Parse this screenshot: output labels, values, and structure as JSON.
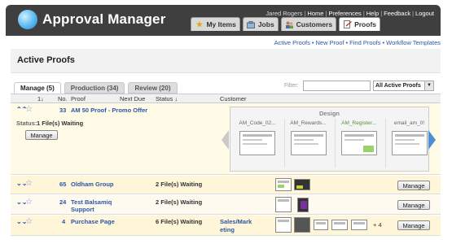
{
  "app": {
    "title": "Approval Manager"
  },
  "user_links": {
    "user": "Jared Rogers",
    "home": "Home",
    "preferences": "Preferences",
    "help": "Help",
    "feedback": "Feedback",
    "logout": "Logout"
  },
  "main_tabs": [
    {
      "label": "My Items",
      "icon": "star-icon"
    },
    {
      "label": "Jobs",
      "icon": "jobs-icon"
    },
    {
      "label": "Customers",
      "icon": "customers-icon"
    },
    {
      "label": "Proofs",
      "icon": "proofs-icon"
    }
  ],
  "subnav": [
    "Active Proofs",
    "New Proof",
    "Find Proofs",
    "Workflow Templates"
  ],
  "page_title": "Active Proofs",
  "subtabs": [
    "Manage (5)",
    "Production (34)",
    "Review (20)"
  ],
  "filter": {
    "label": "Filter:",
    "value": "",
    "select": "All Active Proofs"
  },
  "columns": {
    "sort_num": "1",
    "no": "No.",
    "proof": "Proof",
    "next_due": "Next Due",
    "status": "Status",
    "customer": "Customer"
  },
  "expanded_row": {
    "no": "33",
    "proof": "AM 50 Proof - Promo Offer",
    "status_label": "Status:",
    "status_value": "1 File(s) Waiting",
    "manage": "Manage",
    "panel": {
      "title": "Design",
      "thumbs": [
        "AM_Code_02...",
        "AM_Rewards...",
        "AM_Register...",
        "email_am_0!"
      ]
    }
  },
  "rows": [
    {
      "no": "65",
      "proof": "Oldham Group",
      "status": "2 File(s) Waiting",
      "customer": "",
      "manage": "Manage"
    },
    {
      "no": "24",
      "proof": "Test Balsamiq",
      "proof2": "Support",
      "status": "2 File(s) Waiting",
      "customer": "",
      "manage": "Manage"
    },
    {
      "no": "4",
      "proof": "Purchase Page",
      "status": "6 File(s) Waiting",
      "customer": "Sales/Mark",
      "customer2": "eting",
      "more": "+ 4",
      "manage": "Manage"
    }
  ],
  "colors": {
    "header_bg": "#3f3f3f",
    "link": "#2a56a8",
    "highlight": "#fffbe6",
    "accent_green": "#9bd36b"
  }
}
